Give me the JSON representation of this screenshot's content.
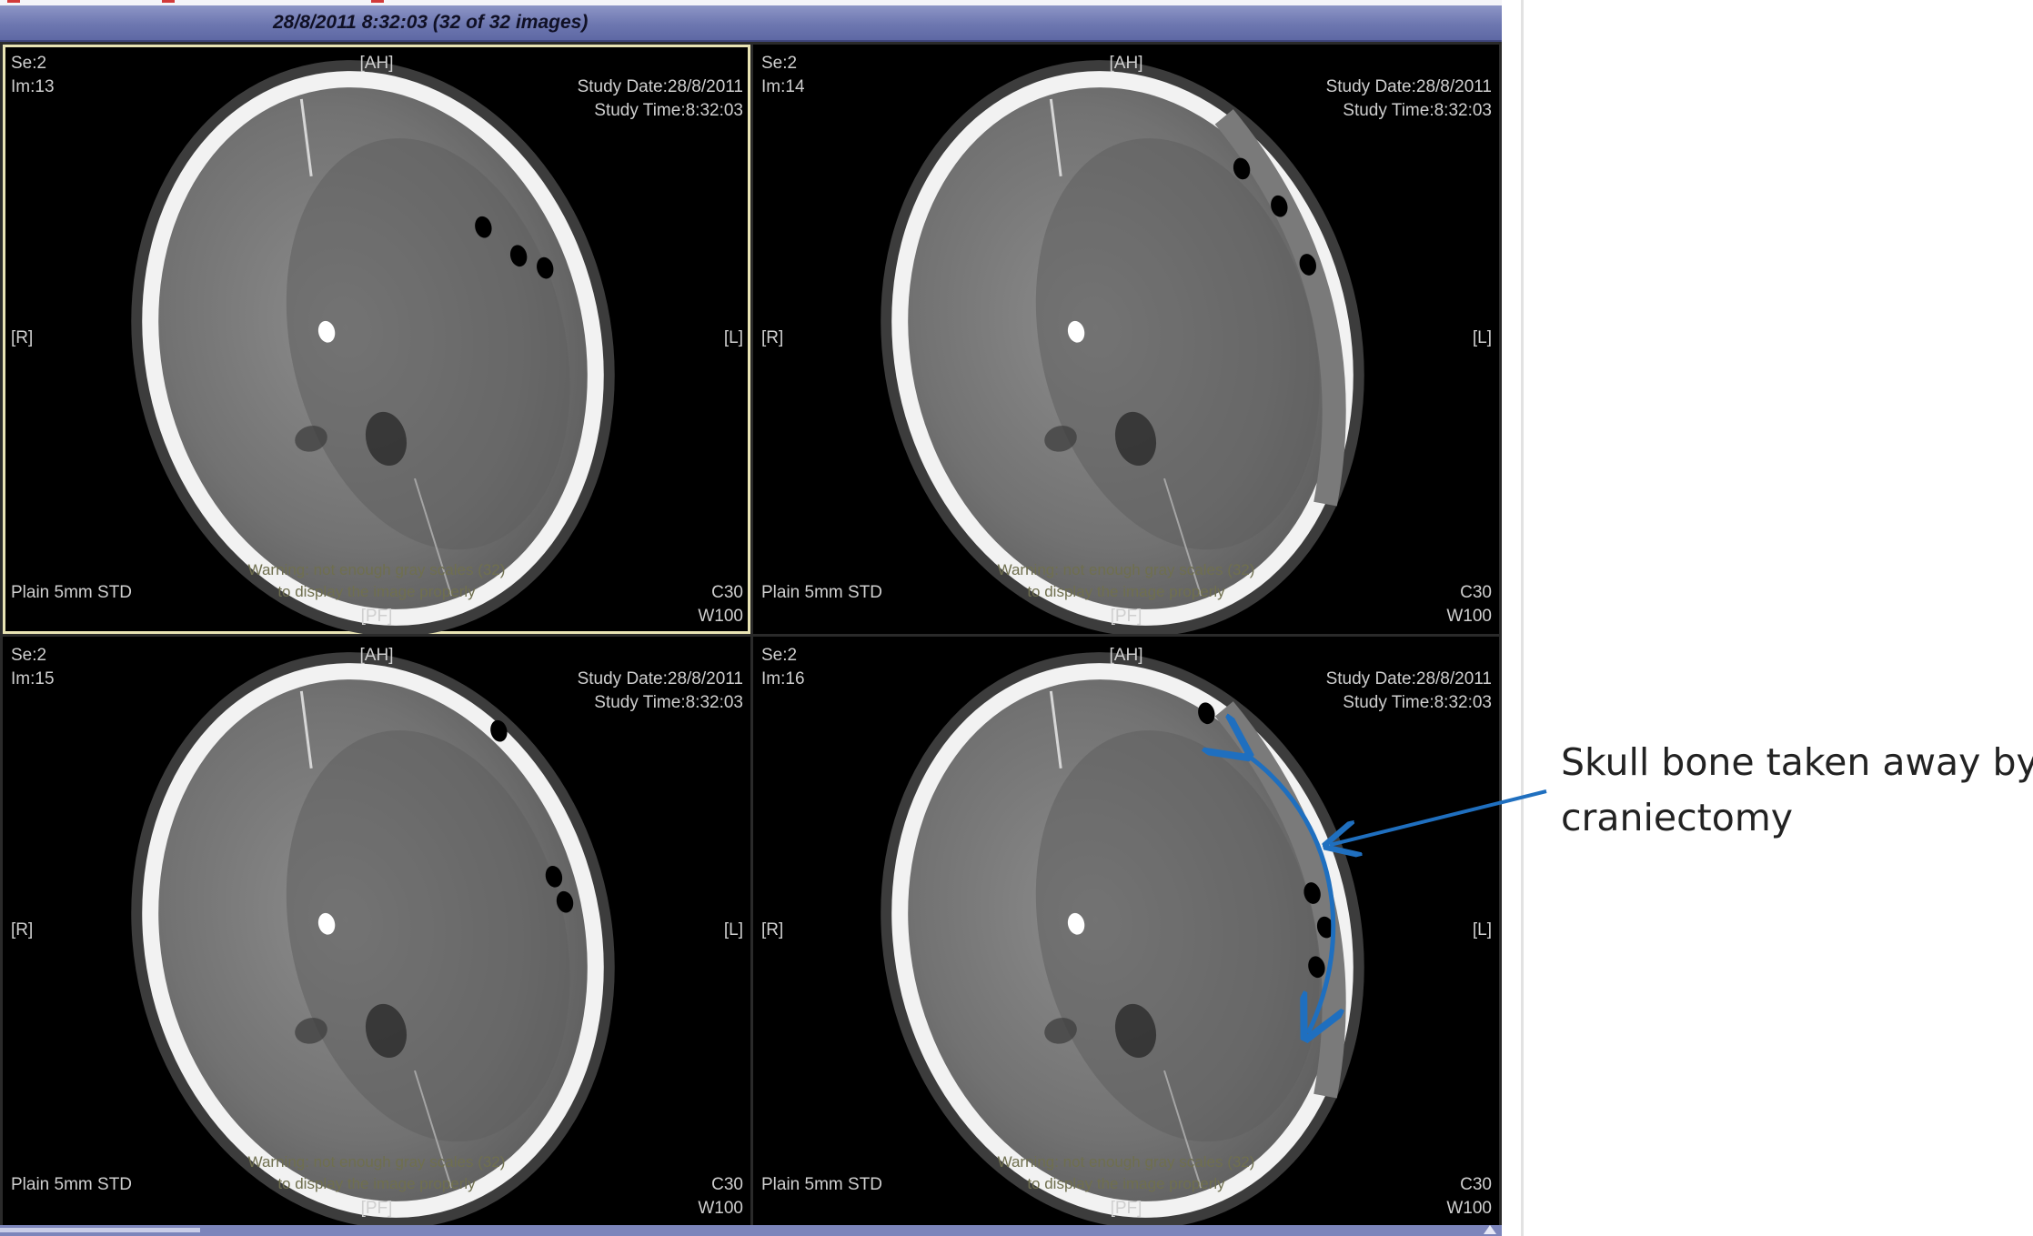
{
  "viewer": {
    "title": "28/8/2011 8:32:03 (32 of 32 images)",
    "accent_color": "#6d77b0"
  },
  "panels": [
    {
      "series": "Se:2",
      "image": "Im:13",
      "orient_top": "[AH]",
      "orient_bottom": "[PF]",
      "orient_left": "[R]",
      "orient_right": "[L]",
      "study_date": "Study Date:28/8/2011",
      "study_time": "Study Time:8:32:03",
      "protocol": "Plain 5mm STD",
      "center": "C30",
      "width": "W100",
      "warning_1": "Warning: not enough gray scales (32)",
      "warning_2": "to display the image properly",
      "selected": true
    },
    {
      "series": "Se:2",
      "image": "Im:14",
      "orient_top": "[AH]",
      "orient_bottom": "[PF]",
      "orient_left": "[R]",
      "orient_right": "[L]",
      "study_date": "Study Date:28/8/2011",
      "study_time": "Study Time:8:32:03",
      "protocol": "Plain 5mm STD",
      "center": "C30",
      "width": "W100",
      "warning_1": "Warning: not enough gray scales (32)",
      "warning_2": "to display the image properly",
      "selected": false
    },
    {
      "series": "Se:2",
      "image": "Im:15",
      "orient_top": "[AH]",
      "orient_bottom": "[PF]",
      "orient_left": "[R]",
      "orient_right": "[L]",
      "study_date": "Study Date:28/8/2011",
      "study_time": "Study Time:8:32:03",
      "protocol": "Plain 5mm STD",
      "center": "C30",
      "width": "W100",
      "warning_1": "Warning: not enough gray scales (32)",
      "warning_2": "to display the image properly",
      "selected": false
    },
    {
      "series": "Se:2",
      "image": "Im:16",
      "orient_top": "[AH]",
      "orient_bottom": "[PF]",
      "orient_left": "[R]",
      "orient_right": "[L]",
      "study_date": "Study Date:28/8/2011",
      "study_time": "Study Time:8:32:03",
      "protocol": "Plain 5mm STD",
      "center": "C30",
      "width": "W100",
      "warning_1": "Warning: not enough gray scales (32)",
      "warning_2": "to display the image properly",
      "selected": false
    }
  ],
  "annotation": {
    "line_1": "Skull bone taken away by",
    "line_2": "craniectomy",
    "color": "#1f6fbf"
  }
}
